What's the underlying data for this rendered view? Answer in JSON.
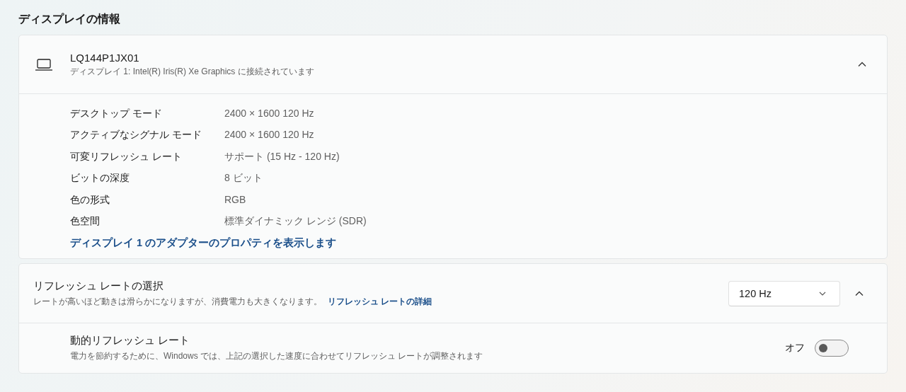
{
  "section_title": "ディスプレイの情報",
  "display_card": {
    "name": "LQ144P1JX01",
    "subtitle": "ディスプレイ 1: Intel(R) Iris(R) Xe Graphics に接続されています",
    "expanded": true,
    "properties": [
      {
        "label": "デスクトップ モード",
        "value": "2400 × 1600 120 Hz"
      },
      {
        "label": "アクティブなシグナル モード",
        "value": "2400 × 1600 120 Hz"
      },
      {
        "label": "可変リフレッシュ レート",
        "value": "サポート (15 Hz - 120 Hz)"
      },
      {
        "label": "ビットの深度",
        "value": "8 ビット"
      },
      {
        "label": "色の形式",
        "value": "RGB"
      },
      {
        "label": "色空間",
        "value": "標準ダイナミック レンジ (SDR)"
      }
    ],
    "link": "ディスプレイ 1 のアダプターのプロパティを表示します"
  },
  "refresh_card": {
    "title": "リフレッシュ レートの選択",
    "description": "レートが高いほど動きは滑らかになりますが、消費電力も大きくなります。",
    "link": "リフレッシュ レートの詳細",
    "dropdown": {
      "value": "120 Hz"
    },
    "expanded": true,
    "dynamic_refresh": {
      "title": "動的リフレッシュ レート",
      "description": "電力を節約するために、Windows では、上記の選択した速度に合わせてリフレッシュ レートが調整されます",
      "state_label": "オフ",
      "on": false
    }
  }
}
